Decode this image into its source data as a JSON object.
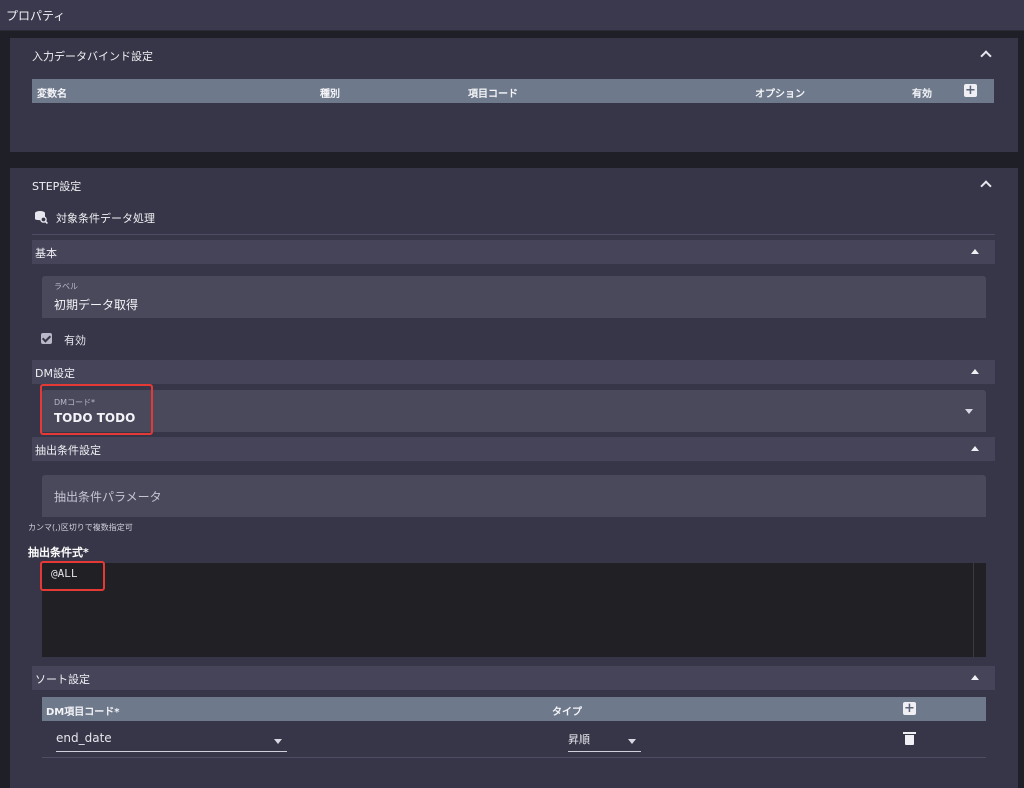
{
  "window": {
    "title": "プロパティ"
  },
  "input_binding": {
    "title": "入力データバインド設定",
    "columns": [
      "変数名",
      "種別",
      "項目コード",
      "オプション",
      "有効"
    ]
  },
  "step": {
    "title": "STEP設定",
    "process_label": "対象条件データ処理",
    "basic": {
      "title": "基本",
      "label_caption": "ラベル",
      "label_value": "初期データ取得",
      "enabled_label": "有効"
    },
    "dm": {
      "title": "DM設定",
      "code_caption": "DMコード*",
      "code_value": "TODO TODO"
    },
    "extract": {
      "title": "抽出条件設定",
      "param_placeholder": "抽出条件パラメータ",
      "hint": "カンマ(,)区切りで複数指定可",
      "expr_label": "抽出条件式*",
      "expr_value": "@ALL"
    },
    "sort": {
      "title": "ソート設定",
      "columns": [
        "DM項目コード*",
        "タイプ"
      ],
      "rows": [
        {
          "code": "end_date",
          "type": "昇順"
        }
      ]
    }
  },
  "colors": {
    "background": "#1f1f28",
    "panel": "#373648",
    "header": "#6e7a8c",
    "highlight": "#e53935"
  }
}
